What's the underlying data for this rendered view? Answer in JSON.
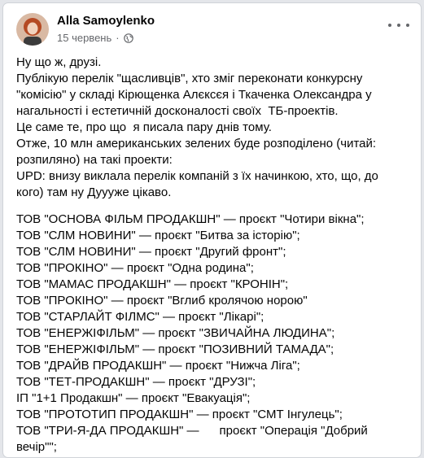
{
  "post": {
    "author": "Alla Samoylenko",
    "date": "15 червень",
    "separator": "·",
    "privacy_icon": "globe-icon",
    "more_icon": "more-options-icon",
    "intro": [
      "Ну що ж, друзі.",
      "Публікую перелік \"щасливців\", хто зміг переконати конкурсну",
      "\"комісію\" у складі Кірющенка Алєксєя і Ткаченка Олександра у",
      "нагальності і естетичній досконалості своїх  ТБ-проектів.",
      "Це саме те, про що  я писала пару днів тому.",
      "Отже, 10 млн американських зелених буде розподілено (читай:",
      "розпиляно) на такі проекти:",
      "UPD: внизу виклала перелік компаній з їх начинкою, хто, що, до",
      "кого) там ну Дуууже цікаво."
    ],
    "projects": [
      "ТОВ \"ОСНОВА ФІЛЬМ ПРОДАКШН\" — проєкт \"Чотири вікна\";",
      "ТОВ \"СЛМ НОВИНИ\" — проєкт \"Битва за історію\";",
      "ТОВ \"СЛМ НОВИНИ\" — проєкт \"Другий фронт\";",
      "ТОВ \"ПРОКІНО\" — проєкт \"Одна родина\";",
      "ТОВ \"МАМАС ПРОДАКШН\" — проєкт \"КРОНІН\";",
      "ТОВ \"ПРОКІНО\" — проєкт \"Вглиб кролячою норою\"",
      "ТОВ \"СТАРЛАЙТ ФІЛМС\" — проєкт \"Лікарі\";",
      "ТОВ \"ЕНЕРЖІФІЛЬМ\" — проєкт \"ЗВИЧАЙНА ЛЮДИНА\";",
      "ТОВ \"ЕНЕРЖІФІЛЬМ\" — проєкт \"ПОЗИВНИЙ ТАМАДА\";",
      "ТОВ \"ДРАЙВ ПРОДАКШН\" — проєкт \"Нижча Ліга\";",
      "ТОВ \"ТЕТ-ПРОДАКШН\" — проєкт \"ДРУЗІ\";",
      "ІП \"1+1 Продакшн\" — проєкт \"Евакуація\";",
      "ТОВ \"ПРОТОТИП ПРОДАКШН\" — проєкт \"СМТ Інгулець\";",
      "ТОВ \"ТРИ-Я-ДА ПРОДАКШН\" —      проєкт \"Операція \"Добрий",
      "вечір\"\";"
    ]
  }
}
